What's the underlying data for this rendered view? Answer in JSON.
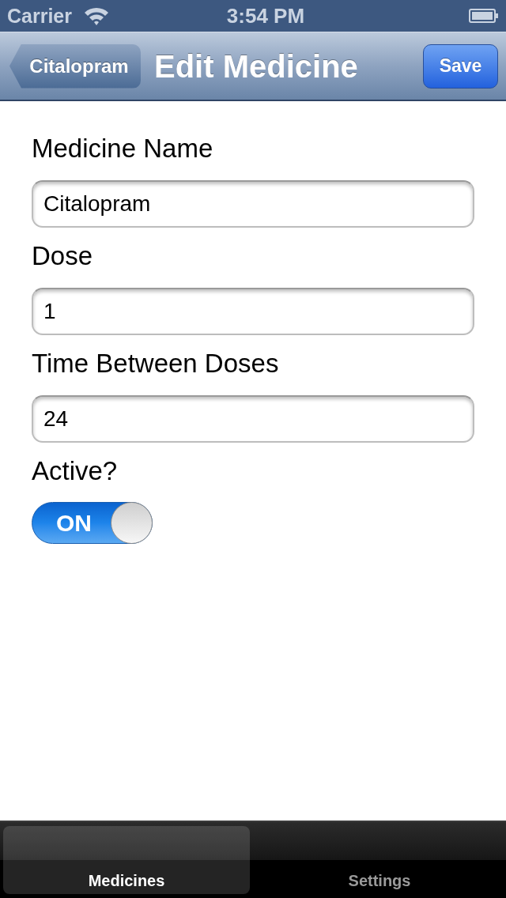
{
  "status_bar": {
    "carrier": "Carrier",
    "time": "3:54 PM"
  },
  "nav_bar": {
    "back_button": "Citalopram",
    "title": "Edit Medicine",
    "save_button": "Save"
  },
  "form": {
    "fields": [
      {
        "label": "Medicine Name",
        "value": "Citalopram"
      },
      {
        "label": "Dose",
        "value": "1"
      },
      {
        "label": "Time Between Doses",
        "value": "24"
      }
    ],
    "active": {
      "label": "Active?",
      "on": true,
      "switch_text": "ON"
    }
  },
  "tab_bar": {
    "tabs": [
      {
        "label": "Medicines",
        "selected": true
      },
      {
        "label": "Settings",
        "selected": false
      }
    ]
  }
}
